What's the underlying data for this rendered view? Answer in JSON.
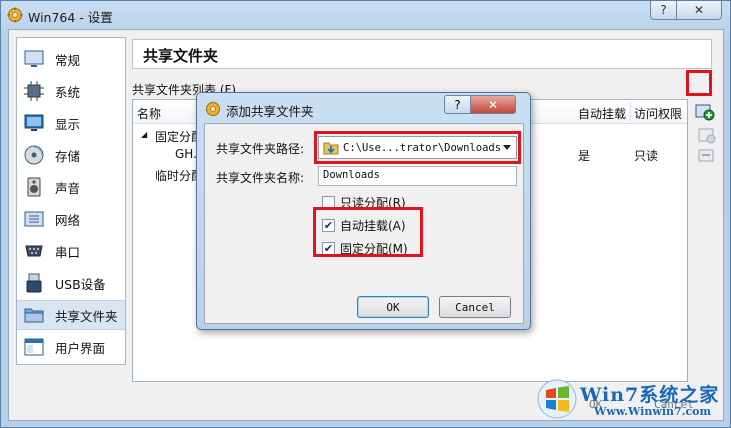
{
  "window": {
    "title": "Win764 - 设置",
    "help_glyph": "?",
    "close_glyph": "✕"
  },
  "sidebar": {
    "items": [
      {
        "label": "常规",
        "icon": "monitor-general-icon"
      },
      {
        "label": "系统",
        "icon": "chip-icon"
      },
      {
        "label": "显示",
        "icon": "display-icon"
      },
      {
        "label": "存储",
        "icon": "disk-icon"
      },
      {
        "label": "声音",
        "icon": "speaker-icon"
      },
      {
        "label": "网络",
        "icon": "network-icon"
      },
      {
        "label": "串口",
        "icon": "serial-port-icon"
      },
      {
        "label": "USB设备",
        "icon": "usb-icon"
      },
      {
        "label": "共享文件夹",
        "icon": "folder-icon",
        "active": true
      },
      {
        "label": "用户界面",
        "icon": "window-ui-icon"
      }
    ]
  },
  "main": {
    "page_title": "共享文件夹",
    "list_caption": "共享文件夹列表 (F)",
    "columns": {
      "name": "名称",
      "auto_mount": "自动挂载",
      "access": "访问权限"
    },
    "groups": [
      {
        "label": "固定分配",
        "rows": [
          {
            "name": "GH...",
            "auto_mount": "是",
            "access": "只读"
          }
        ]
      },
      {
        "label": "临时分配",
        "rows": []
      }
    ]
  },
  "dialog": {
    "title": "添加共享文件夹",
    "help_glyph": "?",
    "close_glyph": "✕",
    "path_label": "共享文件夹路径:",
    "path_value": "C:\\Use...trator\\Downloads",
    "name_label": "共享文件夹名称:",
    "name_value": "Downloads",
    "checkboxes": [
      {
        "label": "只读分配(R)",
        "checked": false
      },
      {
        "label": "自动挂载(A)",
        "checked": true
      },
      {
        "label": "固定分配(M)",
        "checked": true
      }
    ],
    "ok_label": "OK",
    "cancel_label": "Cancel"
  },
  "background": {
    "ok_label": "OK",
    "cancel_label": "Cancel"
  },
  "watermark": {
    "brand": "Win7系统之家",
    "url": "Www.Winwin7.com"
  },
  "colors": {
    "highlight": "#e0141d",
    "titlebar": "#b9d1ea",
    "selection": "#d9e6f2"
  }
}
